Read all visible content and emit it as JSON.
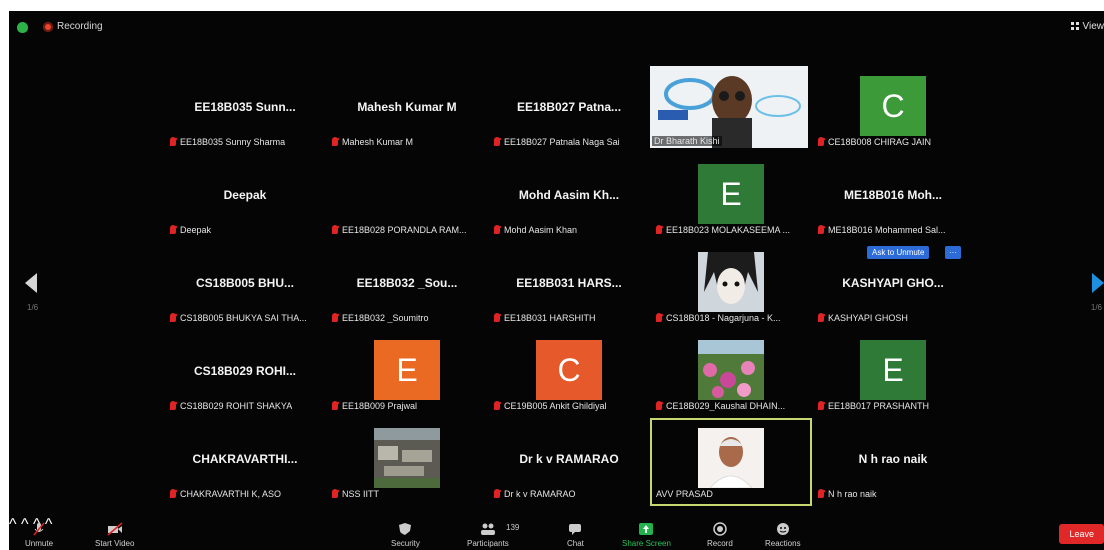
{
  "top_bar": {
    "recording_label": "Recording",
    "view_label": "View"
  },
  "pagination": {
    "left": "1/6",
    "right": "1/6"
  },
  "participants": [
    {
      "display": "EE18B035 Sunn...",
      "label": "EE18B035 Sunny Sharma",
      "type": "name"
    },
    {
      "display": "Mahesh Kumar M",
      "label": "Mahesh Kumar M",
      "type": "name"
    },
    {
      "display": "EE18B027 Patna...",
      "label": "EE18B027 Patnala Naga Sai",
      "type": "name"
    },
    {
      "display": "",
      "label": "Dr Bharath Kishi",
      "type": "video"
    },
    {
      "display": "C",
      "label": "CE18B008 CHIRAG JAIN",
      "type": "avatar",
      "color": "#3d9a39"
    },
    {
      "display": "Deepak",
      "label": "Deepak",
      "type": "name"
    },
    {
      "display": "",
      "label": "EE18B028 PORANDLA RAM...",
      "type": "name"
    },
    {
      "display": "Mohd Aasim Kh...",
      "label": "Mohd Aasim Khan",
      "type": "name"
    },
    {
      "display": "E",
      "label": "EE18B023 MOLAKASEEMA ...",
      "type": "avatar",
      "color": "#2f7a37"
    },
    {
      "display": "ME18B016 Moh...",
      "label": "ME18B016 Mohammed Sal...",
      "type": "name"
    },
    {
      "display": "CS18B005 BHU...",
      "label": "CS18B005 BHUKYA SAI THA...",
      "type": "name"
    },
    {
      "display": "EE18B032 _Sou...",
      "label": "EE18B032 _Soumitro",
      "type": "name"
    },
    {
      "display": "EE18B031 HARS...",
      "label": "EE18B031 HARSHITH",
      "type": "name"
    },
    {
      "display": "",
      "label": "CS18B018 - Nagarjuna - K...",
      "type": "photo-anime"
    },
    {
      "display": "KASHYAPI GHO...",
      "label": "KASHYAPI GHOSH",
      "type": "name"
    },
    {
      "display": "CS18B029 ROHI...",
      "label": "CS18B029 ROHIT SHAKYA",
      "type": "name"
    },
    {
      "display": "E",
      "label": "EE18B009 Prajwal",
      "type": "avatar",
      "color": "#ea6a23"
    },
    {
      "display": "C",
      "label": "CE19B005 Ankit Ghildiyal",
      "type": "avatar",
      "color": "#e5592a"
    },
    {
      "display": "",
      "label": "CE18B029_Kaushal DHAIN...",
      "type": "photo-flowers"
    },
    {
      "display": "E",
      "label": "EE18B017 PRASHANTH",
      "type": "avatar",
      "color": "#2f7a37"
    },
    {
      "display": "CHAKRAVARTHI...",
      "label": "CHAKRAVARTHI K, ASO",
      "type": "name"
    },
    {
      "display": "",
      "label": "NSS IITT",
      "type": "photo-city"
    },
    {
      "display": "Dr k v RAMARAO",
      "label": "Dr k v RAMARAO",
      "type": "name"
    },
    {
      "display": "",
      "label": "AVV PRASAD",
      "type": "photo-man"
    },
    {
      "display": "N h rao naik",
      "label": "N h rao naik",
      "type": "name"
    }
  ],
  "ask_unmute": {
    "label": "Ask to Unmute",
    "more": "···"
  },
  "toolbar": {
    "unmute": "Unmute",
    "start_video": "Start Video",
    "security": "Security",
    "participants": "Participants",
    "participants_count": "139",
    "chat": "Chat",
    "share_screen": "Share Screen",
    "record": "Record",
    "reactions": "Reactions",
    "leave": "Leave"
  },
  "colors": {
    "share_green": "#23b14d",
    "leave_red": "#e02828",
    "active_speaker": "#c8d870",
    "ask_blue": "#2d6cd8"
  }
}
